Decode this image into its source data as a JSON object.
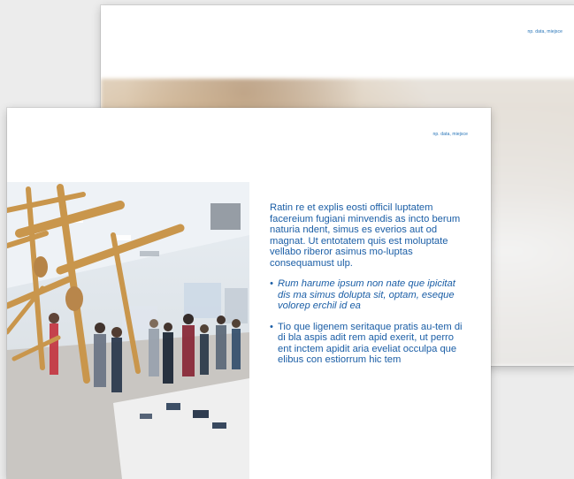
{
  "back_page": {
    "label": "np. data, miejsce"
  },
  "front_page": {
    "label": "np. data, miejsce",
    "paragraph": "Ratin re et explis eosti officil luptatem facereium fugiani minvendis as incto berum naturia ndent, simus es everios aut od magnat. Ut entotatem quis est moluptate vellabo riberor asimus mo-luptas consequamust ulp.",
    "bullets": [
      {
        "text": "Rum harume ipsum non nate que ipicitat dis ma simus dolupta sit, optam, eseque volorep erchil id ea",
        "italic": true
      },
      {
        "text": "Tio que ligenem seritaque pratis au-tem di di bla aspis adit rem apid exerit, ut perro ent inctem apidit aria eveliat occulpa que elibus con estiorrum hic tem",
        "italic": false
      }
    ]
  },
  "colors": {
    "accent_text": "#1b5ea6",
    "background": "#ececec",
    "page": "#ffffff"
  }
}
